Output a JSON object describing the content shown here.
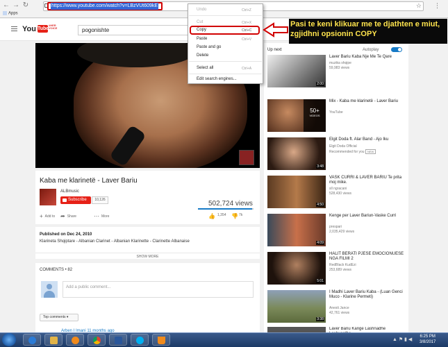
{
  "browser": {
    "url": "https://www.youtube.com/watch?v=LBzVUt609kE",
    "apps_label": "Apps",
    "back": "←",
    "forward": "→",
    "reload": "↻",
    "star": "☆",
    "menu": "⋮"
  },
  "youtube": {
    "logo_you": "You",
    "logo_tube": "Tube",
    "doodle": "#HER VOICE",
    "search_value": "pogonishte"
  },
  "video": {
    "title": "Kaba me klarinetë - Laver Bariu",
    "channel": "ALBmusic",
    "subscribe_label": "Subscribe",
    "subscriber_count": "10,126",
    "views": "502,724 views",
    "like_ratio": 0.97,
    "add_to": "Add to",
    "share": "Share",
    "more": "More",
    "likes": "1,354",
    "dislikes": "7k",
    "published": "Published on Dec 24, 2010",
    "description": "Klarineta Shqiptare - Albanian Clarinet - Albanian Klarinette - Clarinette Albanaise",
    "show_more": "SHOW MORE"
  },
  "comments": {
    "header": "COMMENTS • 82",
    "placeholder": "Add a public comment...",
    "sort": "Top comments ▾",
    "first_commenter": "Arben I Imani  11 months ago"
  },
  "sidebar": {
    "up_next": "Up next",
    "autoplay": "Autoplay",
    "items": [
      {
        "title": "Laver Bariu Kaba Nje Me Te Qare",
        "channel": "muzika shqipe",
        "views": "59,983 views",
        "duration": "2:00",
        "color": "#3b3b3b"
      },
      {
        "title": "Mix - Kaba me klarinetë - Laver Bariu",
        "channel": "YouTube",
        "views": "",
        "duration": "",
        "mix_count": "50+",
        "mix_label": "VIDEOS",
        "color": "#5a3020"
      },
      {
        "title": "Elgit Doda ft. Alar Band - Ajo Iku",
        "channel": "Elgit Doda Official",
        "views": "Recommended for you",
        "badge": "NEW",
        "duration": "3:48",
        "color": "#6e4b3a"
      },
      {
        "title": "VASK CURRI & LAVER BARIU Te prita moj mike.",
        "channel": "sll ngracani",
        "views": "528,430 views",
        "duration": "4:50",
        "color": "#7a5531"
      },
      {
        "title": "Kenge per Laver Bariun-Vaske Curri",
        "channel": "prespari",
        "views": "2,035,429 views",
        "duration": "4:09",
        "color": "#a0513a"
      },
      {
        "title": "HALIT BERATI PJESE EMOCIONUESE NGA FILMI 2",
        "channel": "RedBlack KudEzi",
        "views": "253,689 views",
        "duration": "5:01",
        "color": "#3a2a22"
      },
      {
        "title": "I Madhi Laver Bariu Kaba - (Luan Genci Muco - Klarine Permeti)",
        "channel": "Anesti Jance",
        "views": "42,761 views",
        "duration": "3:38",
        "color": "#7b8a5a"
      },
      {
        "title": "Laver Bariu Kange Lashnadhe Leshverdhe",
        "channel": "",
        "views": "",
        "duration": "",
        "color": "#555"
      }
    ]
  },
  "context_menu": {
    "undo": "Undo",
    "undo_key": "Ctrl+Z",
    "cut": "Cut",
    "cut_key": "Ctrl+X",
    "copy": "Copy",
    "copy_key": "Ctrl+C",
    "paste": "Paste",
    "paste_key": "Ctrl+V",
    "paste_go": "Paste and go",
    "delete": "Delete",
    "select_all": "Select all",
    "select_all_key": "Ctrl+A",
    "edit_search": "Edit search engines..."
  },
  "annotation": {
    "text": "Pasi te keni klikuar me te djathten e miut, zgjidhni opsionin COPY",
    "color": "#ffe44d",
    "highlight_color": "#d10000"
  },
  "taskbar": {
    "time": "6:25 PM",
    "date": "3/8/2017"
  }
}
